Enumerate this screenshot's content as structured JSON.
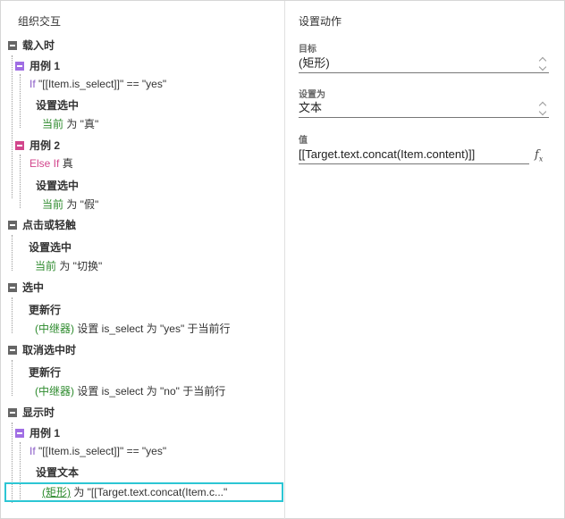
{
  "left_panel": {
    "title": "组织交互",
    "rows": [
      {
        "kind": "event",
        "label": "载入时"
      },
      {
        "kind": "case",
        "label": "用例 1"
      },
      {
        "kind": "cond",
        "keyword": "If",
        "text": "\"[[Item.is_select]]\" == \"yes\""
      },
      {
        "kind": "action",
        "label": "设置选中"
      },
      {
        "kind": "detail",
        "target": "当前",
        "text": " 为 \"真\""
      },
      {
        "kind": "case",
        "label": "用例 2"
      },
      {
        "kind": "cond",
        "keyword": "Else If",
        "text": " 真"
      },
      {
        "kind": "action",
        "label": "设置选中"
      },
      {
        "kind": "detail",
        "target": "当前",
        "text": " 为 \"假\""
      },
      {
        "kind": "event",
        "label": "点击或轻触"
      },
      {
        "kind": "action",
        "label": "设置选中"
      },
      {
        "kind": "detail",
        "target": "当前",
        "text": " 为 \"切换\""
      },
      {
        "kind": "event",
        "label": "选中"
      },
      {
        "kind": "action",
        "label": "更新行"
      },
      {
        "kind": "detail",
        "target": "(中继器)",
        "text": " 设置 is_select 为 \"yes\" 于当前行"
      },
      {
        "kind": "event",
        "label": "取消选中时"
      },
      {
        "kind": "action",
        "label": "更新行"
      },
      {
        "kind": "detail",
        "target": "(中继器)",
        "text": " 设置 is_select 为 \"no\" 于当前行"
      },
      {
        "kind": "event",
        "label": "显示时"
      },
      {
        "kind": "case",
        "label": "用例 1"
      },
      {
        "kind": "cond",
        "keyword": "If",
        "text": "\"[[Item.is_select]]\" == \"yes\""
      },
      {
        "kind": "action",
        "label": "设置文本"
      },
      {
        "kind": "detail",
        "target": "(矩形)",
        "text": " 为 \"[[Target.text.concat(Item.c...\""
      }
    ]
  },
  "right_panel": {
    "title": "设置动作",
    "target_label": "目标",
    "target_value": "(矩形)",
    "set_as_label": "设置为",
    "set_as_value": "文本",
    "value_label": "值",
    "value_text": "[[Target.text.concat(Item.content)]]",
    "fx_symbol": "f",
    "fx_sub": "x"
  },
  "colors": {
    "event_box": "#666666",
    "case_box": "#a06ee4",
    "case_box_else": "#d2468c",
    "target_green": "#2e8b2e",
    "selection_border": "#2cc6d4"
  }
}
